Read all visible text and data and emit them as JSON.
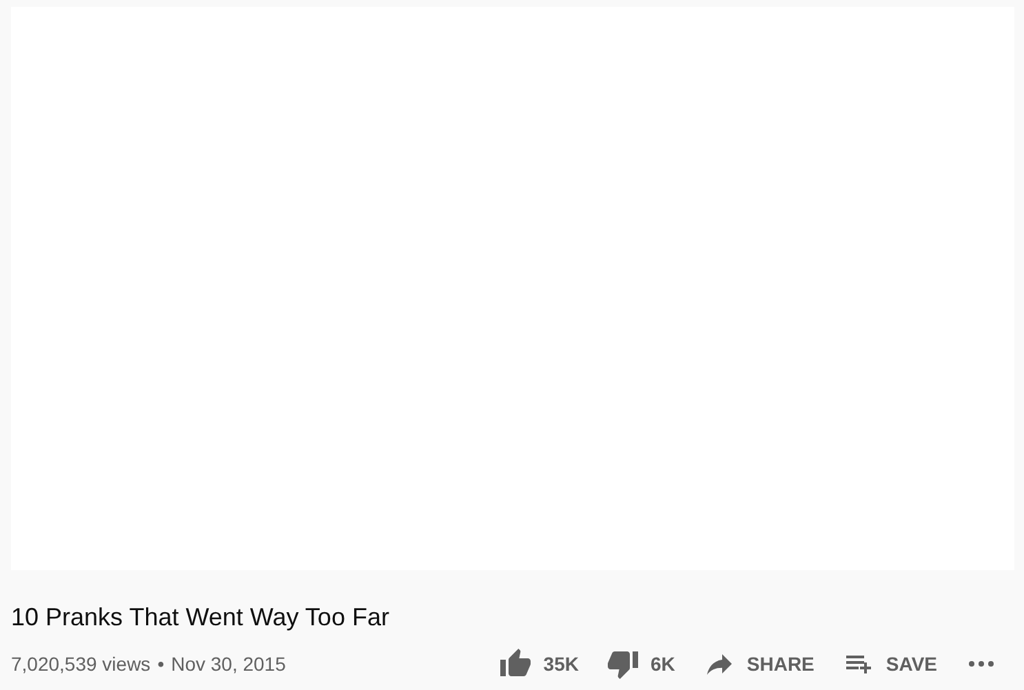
{
  "video": {
    "title": "10 Pranks That Went Way Too Far",
    "views": "7,020,539 views",
    "separator": "•",
    "date": "Nov 30, 2015"
  },
  "actions": [
    {
      "kind": "like",
      "label": "35K"
    },
    {
      "kind": "dislike",
      "label": "6K"
    },
    {
      "kind": "share",
      "label": "SHARE"
    },
    {
      "kind": "save",
      "label": "SAVE"
    },
    {
      "kind": "more"
    }
  ]
}
